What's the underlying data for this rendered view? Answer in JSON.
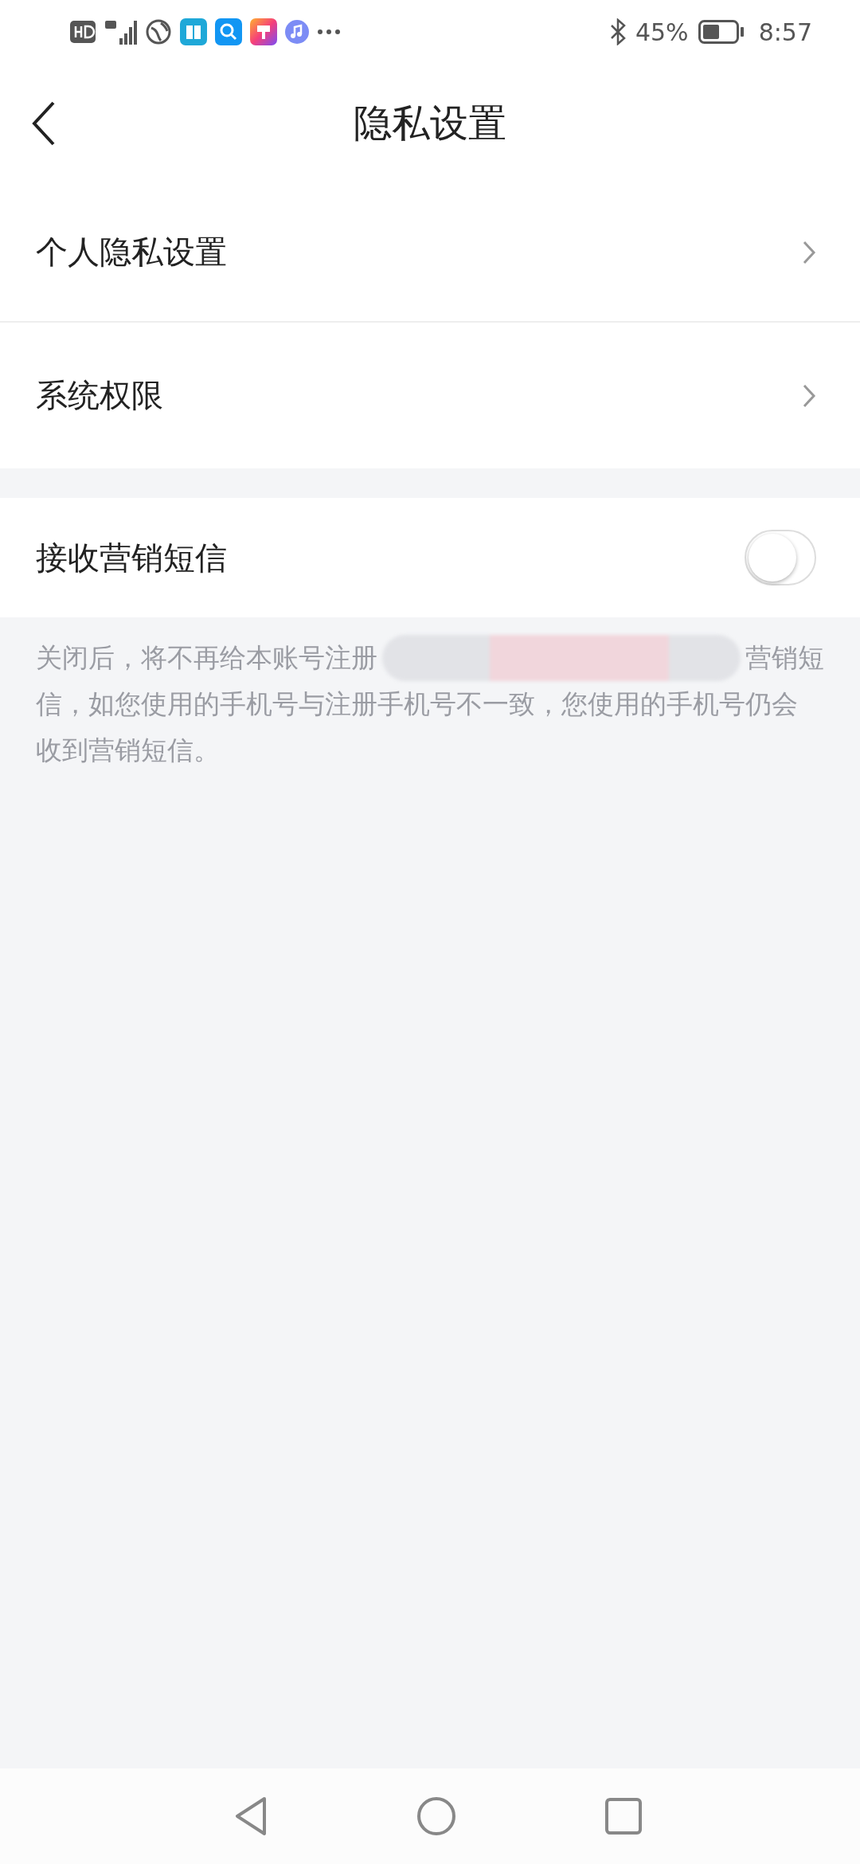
{
  "status_bar": {
    "battery_text": "45%",
    "time": "8:57"
  },
  "header": {
    "title": "隐私设置"
  },
  "settings": [
    {
      "kind": "link",
      "label": "个人隐私设置"
    },
    {
      "kind": "link",
      "label": "系统权限"
    },
    {
      "kind": "toggle",
      "label": "接收营销短信",
      "on": false
    }
  ],
  "notice": {
    "line_start": "关闭后，将不再给本账号注册",
    "line_end": "营销短",
    "continuation": "信，如您使用的手机号与注册手机号不一致，您使用的手机号仍会收到营销短信。"
  }
}
